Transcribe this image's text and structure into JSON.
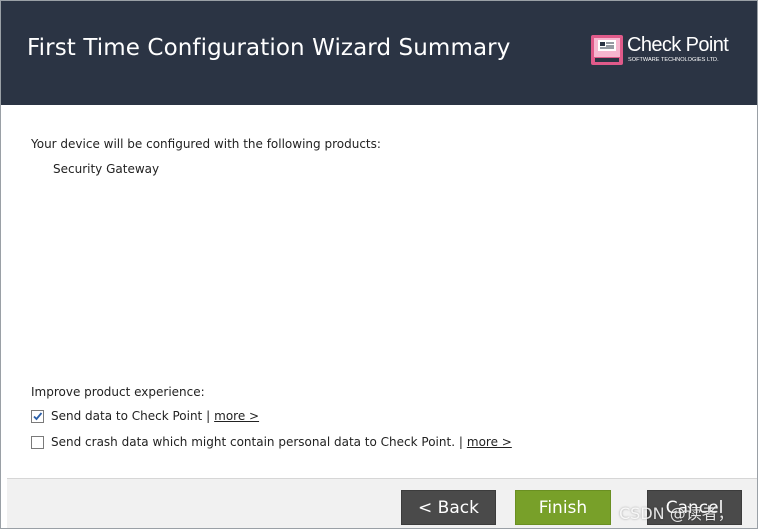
{
  "header": {
    "title": "First Time Configuration Wizard Summary",
    "background": "#2b3444"
  },
  "logo": {
    "name": "Check Point",
    "subtitle": "SOFTWARE TECHNOLOGIES LTD.",
    "icon": "check-point-logo-icon"
  },
  "content": {
    "intro": "Your device will be configured with the following products:",
    "products": [
      "Security Gateway"
    ],
    "improve_label": "Improve product experience:",
    "options": [
      {
        "label": "Send data to Check Point |",
        "more": "more >",
        "checked": true
      },
      {
        "label": "Send crash data which might contain personal data to Check Point. |",
        "more": "more >",
        "checked": false
      }
    ]
  },
  "footer": {
    "back_label": "< Back",
    "finish_label": "Finish",
    "cancel_label": "Cancel",
    "finish_color": "#78a029",
    "button_color": "#4a4a4a"
  },
  "watermark": "CSDN @读者，"
}
